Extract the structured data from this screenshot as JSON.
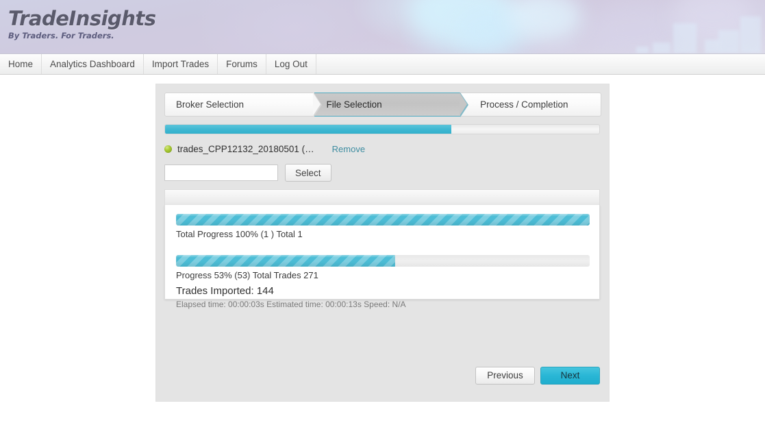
{
  "header": {
    "logo_title": "TradeInsights",
    "logo_tagline": "By Traders. For Traders."
  },
  "nav": {
    "items": [
      {
        "label": "Home"
      },
      {
        "label": "Analytics Dashboard"
      },
      {
        "label": "Import Trades"
      },
      {
        "label": "Forums"
      },
      {
        "label": "Log Out"
      }
    ]
  },
  "wizard": {
    "steps": [
      {
        "label": "Broker Selection",
        "active": false
      },
      {
        "label": "File Selection",
        "active": true
      },
      {
        "label": "Process / Completion",
        "active": false
      }
    ],
    "overall_progress_percent": 66,
    "file": {
      "name": "trades_CPP12132_20180501 (…",
      "status_color": "#a8c932",
      "remove_label": "Remove"
    },
    "select_row": {
      "path_value": "",
      "path_placeholder": "",
      "select_label": "Select"
    },
    "results": {
      "total_progress_percent": 100,
      "total_progress_caption": "Total Progress 100% (1 ) Total 1",
      "trade_progress_percent": 53,
      "trade_progress_caption": "Progress 53% (53) Total Trades 271",
      "imported_label": "Trades Imported: 144",
      "timing_label": "Elapsed time: 00:00:03s Estimated time: 00:00:13s Speed: N/A"
    },
    "footer": {
      "previous_label": "Previous",
      "next_label": "Next"
    }
  },
  "theme": {
    "accent_teal": "#2ab7d6",
    "progress_teal": "#4cbdd6",
    "link_teal": "#3f8da1",
    "card_gray": "#e4e4e4"
  }
}
